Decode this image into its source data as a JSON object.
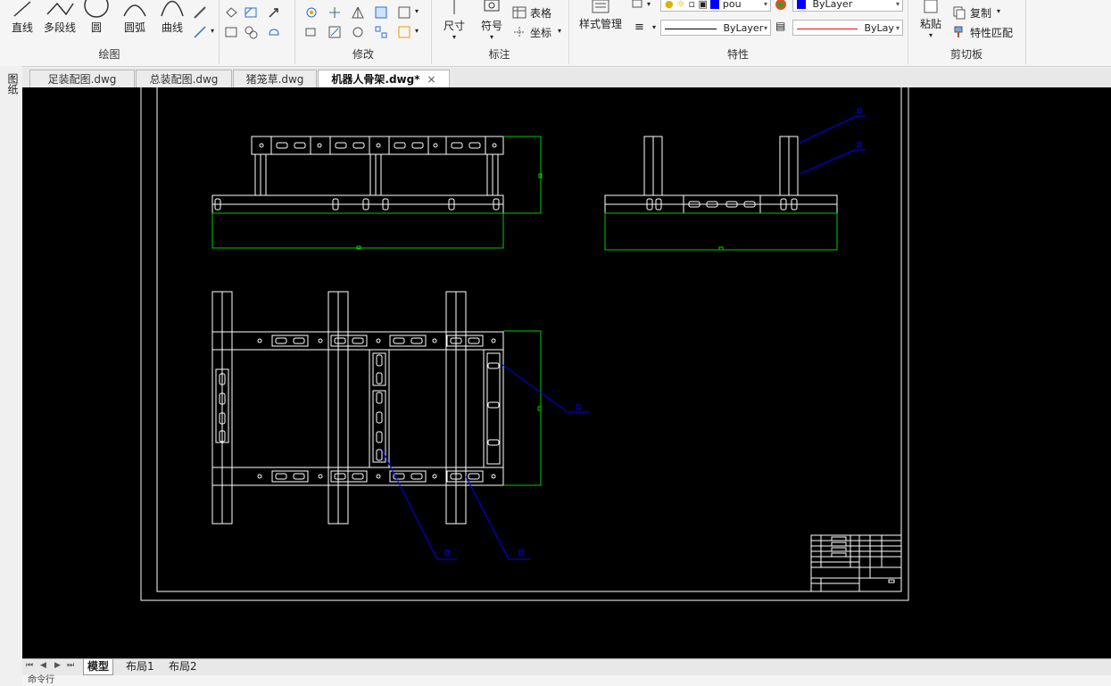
{
  "ribbon": {
    "draw": {
      "title": "绘图",
      "line": "直线",
      "polyline": "多段线",
      "circle": "圆",
      "arc": "圆弧",
      "curve": "曲线"
    },
    "modify": {
      "title": "修改"
    },
    "annotation": {
      "title": "标注",
      "dimension": "尺寸",
      "symbol": "符号",
      "table": "表格",
      "coordinate": "坐标"
    },
    "properties": {
      "title": "特性",
      "style_manager": "样式管理",
      "layer_value": "pou",
      "color_value": "ByLayer",
      "linetype_value": "ByLayer",
      "lineweight_value": "ByLay"
    },
    "clipboard": {
      "title": "剪切板",
      "paste": "粘贴",
      "copy": "复制",
      "match_props": "特性匹配"
    }
  },
  "side_label": "图纸",
  "file_tabs": [
    {
      "label": "足装配图.dwg"
    },
    {
      "label": "总装配图.dwg"
    },
    {
      "label": "猪笼草.dwg"
    },
    {
      "label": "机器人骨架.dwg*",
      "active": true
    }
  ],
  "layout_tabs": [
    {
      "label": "模型",
      "active": true
    },
    {
      "label": "布局1"
    },
    {
      "label": "布局2"
    }
  ],
  "command_prompt": "命令行",
  "colors": {
    "canvas": "#000000",
    "geometry": "#ffffff",
    "boundary": "#00cc00",
    "leader": "#0000ff",
    "line_red": "#ff0000",
    "color_swatch": "#0000ff"
  }
}
